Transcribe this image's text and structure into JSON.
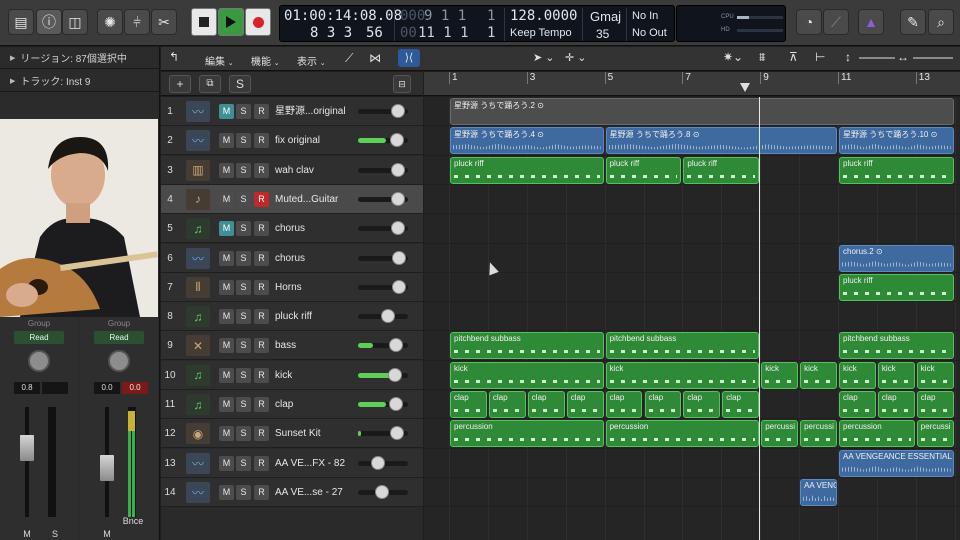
{
  "control_bar": {
    "lcd": {
      "position": "01:00:14:08.08",
      "bars": "8 3 3",
      "sub": "56",
      "beat_dim": "9 1 1",
      "beat_dim_sub": "1",
      "beat2": "11 1 1",
      "beat2_sub": "1",
      "tempo": "128.0000",
      "tempo_mode": "Keep Tempo",
      "key": "Gmaj",
      "key_sub": "35",
      "in_label": "No In",
      "out_label": "No Out"
    },
    "cpu_label": "CPU",
    "hd_label": "HD"
  },
  "inspector": {
    "region_row": "リージョン: 87個選択中",
    "track_row": "トラック: Inst 9",
    "strip_left": {
      "group": "Group",
      "read": "Read",
      "value": "0.8",
      "value2": "",
      "m": "M",
      "s": "S"
    },
    "strip_right": {
      "group": "Group",
      "read": "Read",
      "value": "0.0",
      "value2": "0.0",
      "m": "M",
      "bounce": "Bnce"
    }
  },
  "track_menu": {
    "edit": "編集",
    "function": "機能",
    "view": "表示"
  },
  "subbar": {
    "add": "+",
    "s": "S"
  },
  "ruler": {
    "bars": [
      "1",
      "3",
      "5",
      "7",
      "9",
      "11",
      "13"
    ]
  },
  "tracks": [
    {
      "num": "1",
      "name": "星野源...original",
      "icon": "waveform-icon",
      "m_on": true,
      "r_on": false,
      "vol": 0.8,
      "lvl": 0
    },
    {
      "num": "2",
      "name": "fix original",
      "icon": "waveform-icon",
      "m_on": false,
      "r_on": false,
      "vol": 0.78,
      "lvl": 0.55
    },
    {
      "num": "3",
      "name": "wah clav",
      "icon": "keyboard-icon",
      "m_on": false,
      "r_on": false,
      "vol": 0.8,
      "lvl": 0
    },
    {
      "num": "4",
      "name": "Muted...Guitar",
      "icon": "guitar-icon",
      "m_on": false,
      "r_on": true,
      "vol": 0.8,
      "lvl": 0,
      "selected": true
    },
    {
      "num": "5",
      "name": "chorus",
      "icon": "note-icon",
      "m_on": true,
      "r_on": false,
      "vol": 0.8,
      "lvl": 0
    },
    {
      "num": "6",
      "name": "chorus",
      "icon": "waveform-icon",
      "m_on": false,
      "r_on": false,
      "vol": 0.82,
      "lvl": 0
    },
    {
      "num": "7",
      "name": "Horns",
      "icon": "horns-icon",
      "m_on": false,
      "r_on": false,
      "vol": 0.82,
      "lvl": 0
    },
    {
      "num": "8",
      "name": "pluck riff",
      "icon": "note-icon",
      "m_on": false,
      "r_on": false,
      "vol": 0.6,
      "lvl": 0
    },
    {
      "num": "9",
      "name": "bass",
      "icon": "bass-icon",
      "m_on": false,
      "r_on": false,
      "vol": 0.76,
      "lvl": 0.3
    },
    {
      "num": "10",
      "name": "kick",
      "icon": "note-icon",
      "m_on": false,
      "r_on": false,
      "vol": 0.74,
      "lvl": 0.74
    },
    {
      "num": "11",
      "name": "clap",
      "icon": "note-icon",
      "m_on": false,
      "r_on": false,
      "vol": 0.76,
      "lvl": 0.55
    },
    {
      "num": "12",
      "name": "Sunset Kit",
      "icon": "drumkit-icon",
      "m_on": false,
      "r_on": false,
      "vol": 0.78,
      "lvl": 0.05
    },
    {
      "num": "13",
      "name": "AA VE...FX - 82",
      "icon": "waveform-icon",
      "m_on": false,
      "r_on": false,
      "vol": 0.4,
      "lvl": 0
    },
    {
      "num": "14",
      "name": "AA VE...se - 27",
      "icon": "waveform-icon",
      "m_on": false,
      "r_on": false,
      "vol": 0.48,
      "lvl": 0
    }
  ],
  "regions": [
    {
      "track": 0,
      "start": 1,
      "end": 14,
      "kind": "grey",
      "name": "星野源 うちで踊ろう.2 ⊙"
    },
    {
      "track": 1,
      "start": 1,
      "end": 5,
      "kind": "audio",
      "name": "星野源 うちで踊ろう.4 ⊙"
    },
    {
      "track": 1,
      "start": 5,
      "end": 11,
      "kind": "audio",
      "name": "星野源 うちで踊ろう.8 ⊙"
    },
    {
      "track": 1,
      "start": 11,
      "end": 14,
      "kind": "audio",
      "name": "星野源 うちで踊ろう.10 ⊙"
    },
    {
      "track": 2,
      "start": 1,
      "end": 5,
      "kind": "midi",
      "name": "pluck riff"
    },
    {
      "track": 2,
      "start": 5,
      "end": 7,
      "kind": "midi",
      "name": "pluck riff"
    },
    {
      "track": 2,
      "start": 7,
      "end": 9,
      "kind": "midi",
      "name": "pluck riff"
    },
    {
      "track": 2,
      "start": 11,
      "end": 14,
      "kind": "midi",
      "name": "pluck riff"
    },
    {
      "track": 5,
      "start": 11,
      "end": 14,
      "kind": "audio",
      "name": "chorus.2 ⊙"
    },
    {
      "track": 6,
      "start": 11,
      "end": 14,
      "kind": "midi",
      "name": "pluck riff"
    },
    {
      "track": 8,
      "start": 1,
      "end": 5,
      "kind": "midi",
      "name": "pitchbend subbass"
    },
    {
      "track": 8,
      "start": 5,
      "end": 9,
      "kind": "midi",
      "name": "pitchbend subbass"
    },
    {
      "track": 8,
      "start": 11,
      "end": 14,
      "kind": "midi",
      "name": "pitchbend subbass"
    },
    {
      "track": 9,
      "start": 1,
      "end": 5,
      "kind": "midi",
      "name": "kick"
    },
    {
      "track": 9,
      "start": 5,
      "end": 9,
      "kind": "midi",
      "name": "kick"
    },
    {
      "track": 9,
      "start": 9,
      "end": 10,
      "kind": "midi",
      "name": "kick"
    },
    {
      "track": 9,
      "start": 10,
      "end": 11,
      "kind": "midi",
      "name": "kick"
    },
    {
      "track": 9,
      "start": 11,
      "end": 12,
      "kind": "midi",
      "name": "kick"
    },
    {
      "track": 9,
      "start": 12,
      "end": 13,
      "kind": "midi",
      "name": "kick"
    },
    {
      "track": 9,
      "start": 13,
      "end": 14,
      "kind": "midi",
      "name": "kick"
    },
    {
      "track": 10,
      "start": 1,
      "end": 2,
      "kind": "midi",
      "name": "clap"
    },
    {
      "track": 10,
      "start": 2,
      "end": 3,
      "kind": "midi",
      "name": "clap"
    },
    {
      "track": 10,
      "start": 3,
      "end": 4,
      "kind": "midi",
      "name": "clap"
    },
    {
      "track": 10,
      "start": 4,
      "end": 5,
      "kind": "midi",
      "name": "clap"
    },
    {
      "track": 10,
      "start": 5,
      "end": 6,
      "kind": "midi",
      "name": "clap"
    },
    {
      "track": 10,
      "start": 6,
      "end": 7,
      "kind": "midi",
      "name": "clap"
    },
    {
      "track": 10,
      "start": 7,
      "end": 8,
      "kind": "midi",
      "name": "clap"
    },
    {
      "track": 10,
      "start": 8,
      "end": 9,
      "kind": "midi",
      "name": "clap"
    },
    {
      "track": 10,
      "start": 11,
      "end": 12,
      "kind": "midi",
      "name": "clap"
    },
    {
      "track": 10,
      "start": 12,
      "end": 13,
      "kind": "midi",
      "name": "clap"
    },
    {
      "track": 10,
      "start": 13,
      "end": 14,
      "kind": "midi",
      "name": "clap"
    },
    {
      "track": 11,
      "start": 1,
      "end": 5,
      "kind": "midi",
      "name": "percussion"
    },
    {
      "track": 11,
      "start": 5,
      "end": 9,
      "kind": "midi",
      "name": "percussion"
    },
    {
      "track": 11,
      "start": 9,
      "end": 10,
      "kind": "midi",
      "name": "percussi"
    },
    {
      "track": 11,
      "start": 10,
      "end": 11,
      "kind": "midi",
      "name": "percussi"
    },
    {
      "track": 11,
      "start": 11,
      "end": 13,
      "kind": "midi",
      "name": "percussion"
    },
    {
      "track": 11,
      "start": 13,
      "end": 14,
      "kind": "midi",
      "name": "percussi"
    },
    {
      "track": 12,
      "start": 11,
      "end": 14,
      "kind": "audio",
      "name": "AA VENGEANCE ESSENTIAL H"
    },
    {
      "track": 13,
      "start": 10,
      "end": 11,
      "kind": "audio",
      "name": "AA VENG"
    }
  ],
  "playhead_bar": 9.0
}
